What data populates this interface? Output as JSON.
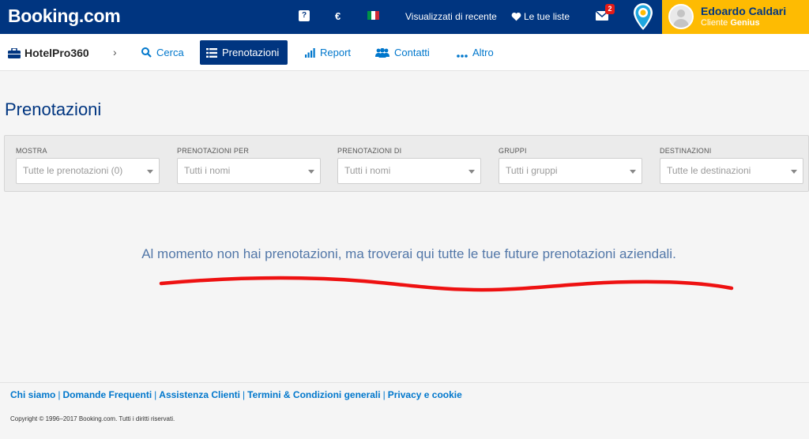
{
  "topbar": {
    "logo": "Booking.com",
    "help_icon": "?",
    "currency": "€",
    "flag_colors": [
      "#009246",
      "#ffffff",
      "#ce2b37"
    ],
    "recent_label": "Visualizzati di recente",
    "lists_label": "Le tue liste",
    "mail_count": "2",
    "user": {
      "name": "Edoardo Caldari",
      "subtitle_prefix": "Cliente",
      "subtitle_level": "Genius"
    }
  },
  "subnav": {
    "brand": "HotelPro360",
    "chevron": "›",
    "items": [
      {
        "label": "Cerca",
        "icon": "search-icon"
      },
      {
        "label": "Prenotazioni",
        "icon": "list-icon",
        "active": true
      },
      {
        "label": "Report",
        "icon": "bar-chart-icon"
      },
      {
        "label": "Contatti",
        "icon": "people-icon"
      },
      {
        "label": "Altro",
        "icon": "dots-icon"
      }
    ]
  },
  "page": {
    "title": "Prenotazioni"
  },
  "filters": [
    {
      "label": "MOSTRA",
      "value": "Tutte le prenotazioni (0)"
    },
    {
      "label": "PRENOTAZIONI PER",
      "value": "Tutti i nomi"
    },
    {
      "label": "PRENOTAZIONI DI",
      "value": "Tutti i nomi"
    },
    {
      "label": "GRUPPI",
      "value": "Tutti i gruppi"
    },
    {
      "label": "DESTINAZIONI",
      "value": "Tutte le destinazioni"
    }
  ],
  "empty_message": "Al momento non hai prenotazioni, ma troverai qui tutte le tue future prenotazioni aziendali.",
  "colors": {
    "brand_blue": "#003580",
    "genius_yellow": "#febb02",
    "link_blue": "#0077cc",
    "annotation_red": "#ee1111"
  },
  "footer": {
    "links": [
      "Chi siamo",
      "Domande Frequenti",
      "Assistenza Clienti",
      "Termini & Condizioni generali",
      "Privacy e cookie"
    ],
    "copyright": "Copyright © 1996–2017 Booking.com. Tutti i diritti riservati."
  }
}
